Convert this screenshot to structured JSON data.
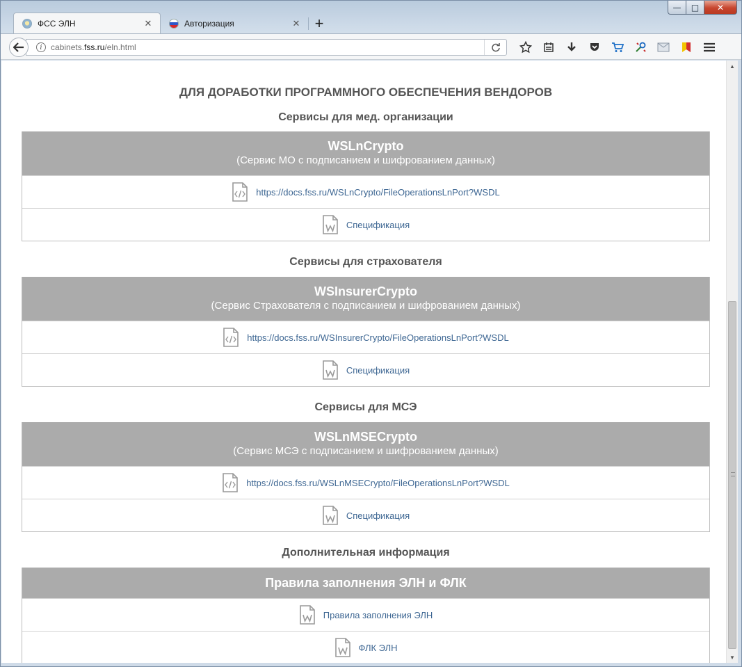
{
  "browser": {
    "tabs": [
      {
        "title": "ФСС ЭЛН",
        "active": true
      },
      {
        "title": "Авторизация",
        "active": false
      }
    ],
    "new_tab_label": "+",
    "url_prefix": "cabinets.",
    "url_host": "fss.ru",
    "url_path": "/eln.html",
    "window_controls": {
      "minimize": "—",
      "maximize": "□",
      "close": "✕"
    }
  },
  "page": {
    "main_title": "ДЛЯ ДОРАБОТКИ ПРОГРАММНОГО ОБЕСПЕЧЕНИЯ ВЕНДОРОВ",
    "sections": [
      {
        "title": "Сервисы для мед. организации",
        "card_title": "WSLnCrypto",
        "card_subtitle": "(Сервис МО с подписанием и шифрованием данных)",
        "rows": [
          {
            "icon": "code-file-icon",
            "text": "https://docs.fss.ru/WSLnCrypto/FileOperationsLnPort?WSDL"
          },
          {
            "icon": "word-file-icon",
            "text": "Спецификация"
          }
        ]
      },
      {
        "title": "Сервисы для страхователя",
        "card_title": "WSInsurerCrypto",
        "card_subtitle": "(Сервис Страхователя с подписанием и шифрованием данных)",
        "rows": [
          {
            "icon": "code-file-icon",
            "text": "https://docs.fss.ru/WSInsurerCrypto/FileOperationsLnPort?WSDL"
          },
          {
            "icon": "word-file-icon",
            "text": "Спецификация"
          }
        ]
      },
      {
        "title": "Сервисы для МСЭ",
        "card_title": "WSLnMSECrypto",
        "card_subtitle": "(Сервис МСЭ с подписанием и шифрованием данных)",
        "rows": [
          {
            "icon": "code-file-icon",
            "text": "https://docs.fss.ru/WSLnMSECrypto/FileOperationsLnPort?WSDL"
          },
          {
            "icon": "word-file-icon",
            "text": "Спецификация"
          }
        ]
      },
      {
        "title": "Дополнительная информация",
        "card_title": "Правила заполнения ЭЛН и ФЛК",
        "rows": [
          {
            "icon": "word-file-icon",
            "text": "Правила заполнения ЭЛН"
          },
          {
            "icon": "word-file-icon",
            "text": "ФЛК ЭЛН"
          }
        ]
      }
    ]
  },
  "colors": {
    "card_header_bg": "#ababab",
    "link": "#3e6793",
    "heading": "#555555"
  }
}
